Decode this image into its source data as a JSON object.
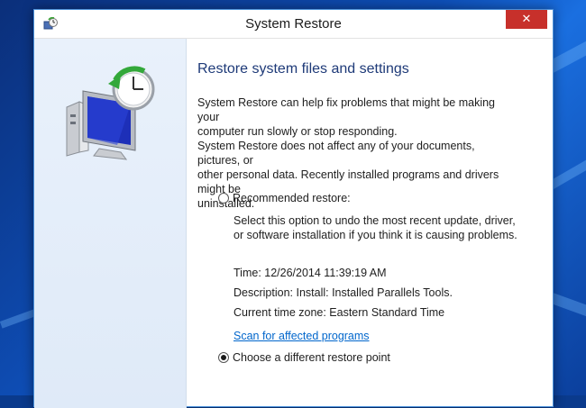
{
  "window": {
    "title": "System Restore",
    "close_label": "✕"
  },
  "main": {
    "heading": "Restore system files and settings",
    "intro_line1": "System Restore can help fix problems that might be making your",
    "intro_line2": "computer run slowly or stop responding.",
    "note_line1": "System Restore does not affect any of your documents, pictures, or",
    "note_line2": "other personal data. Recently installed programs and drivers might be",
    "note_line3": "uninstalled.",
    "recommended": {
      "label": "Recommended restore:",
      "selected": false,
      "desc_line1": "Select this option to undo the most recent update, driver,",
      "desc_line2": "or software installation if you think it is causing problems.",
      "time": "Time: 12/26/2014 11:39:19 AM",
      "description": "Description: Install: Installed Parallels Tools.",
      "timezone": "Current time zone: Eastern Standard Time",
      "scan_link": "Scan for affected programs"
    },
    "different": {
      "label": "Choose a different restore point",
      "selected": true
    }
  },
  "icons": {
    "title_icon": "system-restore-icon",
    "illustration": "computer-restore-clock-icon"
  },
  "colors": {
    "close_button": "#c7302b",
    "link": "#0066cc",
    "heading": "#1e3a78"
  }
}
